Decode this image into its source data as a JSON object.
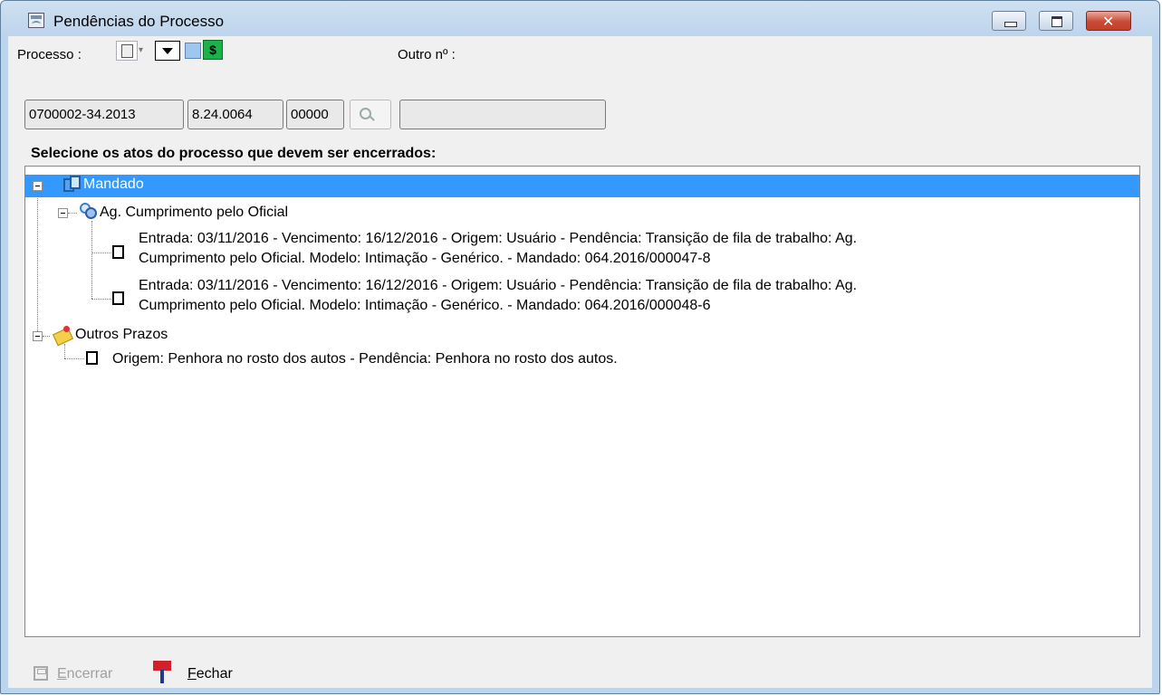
{
  "window": {
    "title": "Pendências do Processo"
  },
  "form": {
    "processo_label": "Processo :",
    "outro_label": "Outro nº :",
    "processo_parts": [
      "0700002-34.2013",
      "8.24.0064",
      "00000"
    ],
    "outro_value": ""
  },
  "instruction": "Selecione os atos do processo que devem ser encerrados:",
  "tree": {
    "mandado": {
      "label": "Mandado",
      "selected": true,
      "children": {
        "ag_cumprimento": {
          "label": "Ag. Cumprimento pelo Oficial",
          "items": [
            {
              "line1": "Entrada: 03/11/2016 - Vencimento: 16/12/2016 - Origem: Usuário - Pendência: Transição de fila de trabalho: Ag.",
              "line2": "Cumprimento pelo Oficial. Modelo: Intimação - Genérico. - Mandado: 064.2016/000047-8",
              "checked": false
            },
            {
              "line1": "Entrada: 03/11/2016 - Vencimento: 16/12/2016 - Origem: Usuário - Pendência: Transição de fila de trabalho: Ag.",
              "line2": "Cumprimento pelo Oficial. Modelo: Intimação - Genérico. - Mandado: 064.2016/000048-6",
              "checked": false
            }
          ]
        }
      }
    },
    "outros_prazos": {
      "label": "Outros Prazos",
      "items": [
        {
          "line1": "Origem: Penhora no rosto dos autos - Pendência: Penhora no rosto dos autos.",
          "checked": false
        }
      ]
    }
  },
  "footer": {
    "encerrar_first": "E",
    "encerrar_rest": "ncerrar",
    "fechar_first": "F",
    "fechar_rest": "echar"
  },
  "colors": {
    "selection": "#3399ff",
    "frame": "#bcd4ec",
    "fechar_flag": "#d0202a"
  }
}
